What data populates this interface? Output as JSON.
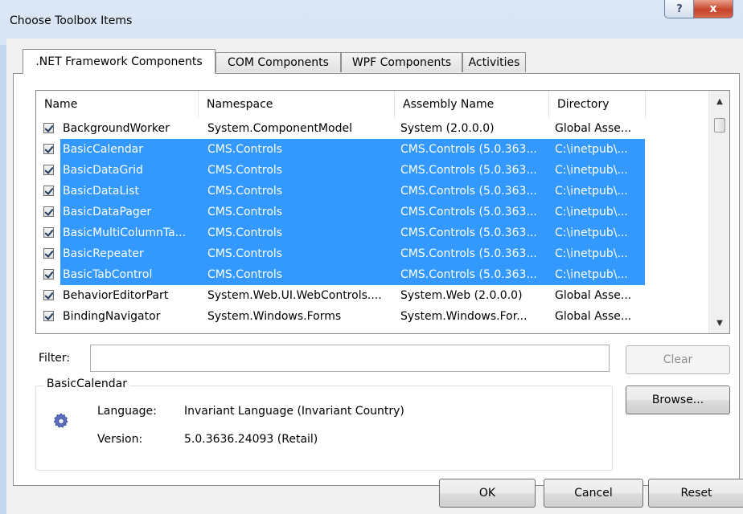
{
  "window": {
    "title": "Choose Toolbox Items",
    "help_glyph": "?",
    "close_glyph": "x"
  },
  "tabs": [
    {
      "label": ".NET Framework Components",
      "active": true
    },
    {
      "label": "COM Components",
      "active": false
    },
    {
      "label": "WPF Components",
      "active": false
    },
    {
      "label": "Activities",
      "active": false
    }
  ],
  "list": {
    "columns": [
      "Name",
      "Namespace",
      "Assembly Name",
      "Directory"
    ],
    "rows": [
      {
        "checked": true,
        "selected": false,
        "name": "BackgroundWorker",
        "namespace": "System.ComponentModel",
        "assembly": "System (2.0.0.0)",
        "directory": "Global Asse..."
      },
      {
        "checked": true,
        "selected": true,
        "name": "BasicCalendar",
        "namespace": "CMS.Controls",
        "assembly": "CMS.Controls (5.0.363...",
        "directory": "C:\\inetpub\\..."
      },
      {
        "checked": true,
        "selected": true,
        "name": "BasicDataGrid",
        "namespace": "CMS.Controls",
        "assembly": "CMS.Controls (5.0.363...",
        "directory": "C:\\inetpub\\..."
      },
      {
        "checked": true,
        "selected": true,
        "name": "BasicDataList",
        "namespace": "CMS.Controls",
        "assembly": "CMS.Controls (5.0.363...",
        "directory": "C:\\inetpub\\..."
      },
      {
        "checked": true,
        "selected": true,
        "name": "BasicDataPager",
        "namespace": "CMS.Controls",
        "assembly": "CMS.Controls (5.0.363...",
        "directory": "C:\\inetpub\\..."
      },
      {
        "checked": true,
        "selected": true,
        "name": "BasicMultiColumnTa...",
        "namespace": "CMS.Controls",
        "assembly": "CMS.Controls (5.0.363...",
        "directory": "C:\\inetpub\\..."
      },
      {
        "checked": true,
        "selected": true,
        "name": "BasicRepeater",
        "namespace": "CMS.Controls",
        "assembly": "CMS.Controls (5.0.363...",
        "directory": "C:\\inetpub\\..."
      },
      {
        "checked": true,
        "selected": true,
        "name": "BasicTabControl",
        "namespace": "CMS.Controls",
        "assembly": "CMS.Controls (5.0.363...",
        "directory": "C:\\inetpub\\..."
      },
      {
        "checked": true,
        "selected": false,
        "name": "BehaviorEditorPart",
        "namespace": "System.Web.UI.WebControls....",
        "assembly": "System.Web (2.0.0.0)",
        "directory": "Global Asse..."
      },
      {
        "checked": true,
        "selected": false,
        "name": "BindingNavigator",
        "namespace": "System.Windows.Forms",
        "assembly": "System.Windows.For...",
        "directory": "Global Asse..."
      }
    ]
  },
  "filter": {
    "label": "Filter:",
    "value": "",
    "clear_label": "Clear"
  },
  "details": {
    "group_title": "BasicCalendar",
    "language_label": "Language:",
    "language_value": "Invariant Language (Invariant Country)",
    "version_label": "Version:",
    "version_value": "5.0.3636.24093 (Retail)"
  },
  "buttons": {
    "browse": "Browse...",
    "ok": "OK",
    "cancel": "Cancel",
    "reset": "Reset"
  },
  "colors": {
    "selection": "#3399ff",
    "titlebar": "#c9daf0",
    "close_button": "#c7432a"
  },
  "icons": {
    "component": "gear-icon",
    "scroll_up": "chevron-up-icon",
    "scroll_down": "chevron-down-icon"
  }
}
